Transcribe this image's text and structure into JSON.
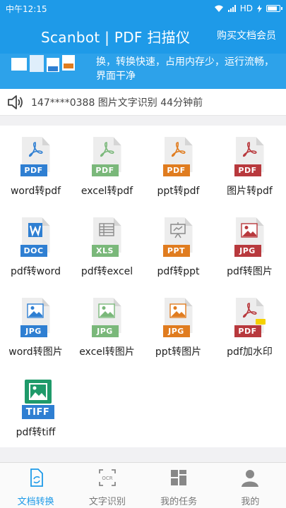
{
  "status": {
    "time": "中午12:15",
    "network": "HD"
  },
  "header": {
    "title": "Scanbot | PDF 扫描仪",
    "vip": "购买文档会员"
  },
  "banner": {
    "text": "换，转换快速，占用内存少，运行流畅，界面干净"
  },
  "notice": {
    "text": "147****0388 图片文字识别 44分钟前"
  },
  "tools": [
    {
      "label": "word转pdf",
      "tag": "PDF",
      "color": "#2f7fd2",
      "glyph": "pdf",
      "glyphColor": "#2f7fd2"
    },
    {
      "label": "excel转pdf",
      "tag": "PDF",
      "color": "#7ab87a",
      "glyph": "pdf",
      "glyphColor": "#7ab87a"
    },
    {
      "label": "ppt转pdf",
      "tag": "PDF",
      "color": "#e07c1f",
      "glyph": "pdf",
      "glyphColor": "#e07c1f"
    },
    {
      "label": "图片转pdf",
      "tag": "PDF",
      "color": "#b8393d",
      "glyph": "pdf",
      "glyphColor": "#b8393d"
    },
    {
      "label": "pdf转word",
      "tag": "DOC",
      "color": "#2f7fd2",
      "glyph": "word",
      "glyphColor": "#2f7fd2"
    },
    {
      "label": "pdf转excel",
      "tag": "XLS",
      "color": "#7ab87a",
      "glyph": "sheet",
      "glyphColor": "#8a8a8a"
    },
    {
      "label": "pdf转ppt",
      "tag": "PPT",
      "color": "#e07c1f",
      "glyph": "board",
      "glyphColor": "#8a8a8a"
    },
    {
      "label": "pdf转图片",
      "tag": "JPG",
      "color": "#b8393d",
      "glyph": "image",
      "glyphColor": "#b8393d"
    },
    {
      "label": "word转图片",
      "tag": "JPG",
      "color": "#2f7fd2",
      "glyph": "image",
      "glyphColor": "#2f7fd2"
    },
    {
      "label": "excel转图片",
      "tag": "JPG",
      "color": "#7ab87a",
      "glyph": "image",
      "glyphColor": "#7ab87a"
    },
    {
      "label": "ppt转图片",
      "tag": "JPG",
      "color": "#e07c1f",
      "glyph": "image",
      "glyphColor": "#e07c1f"
    },
    {
      "label": "pdf加水印",
      "tag": "PDF",
      "color": "#b8393d",
      "glyph": "pdf-mark",
      "glyphColor": "#b8393d"
    },
    {
      "label": "pdf转tiff",
      "tag": "TIFF",
      "color": "#1f9a6a",
      "glyph": "tiff",
      "glyphColor": "#1f9a6a"
    }
  ],
  "tabs": [
    {
      "label": "文档转换",
      "icon": "doc-convert-icon",
      "active": true
    },
    {
      "label": "文字识别",
      "icon": "ocr-icon",
      "active": false
    },
    {
      "label": "我的任务",
      "icon": "tasks-icon",
      "active": false
    },
    {
      "label": "我的",
      "icon": "profile-icon",
      "active": false
    }
  ],
  "colors": {
    "primary": "#1e9ae8",
    "banner": "#2da2ea"
  }
}
